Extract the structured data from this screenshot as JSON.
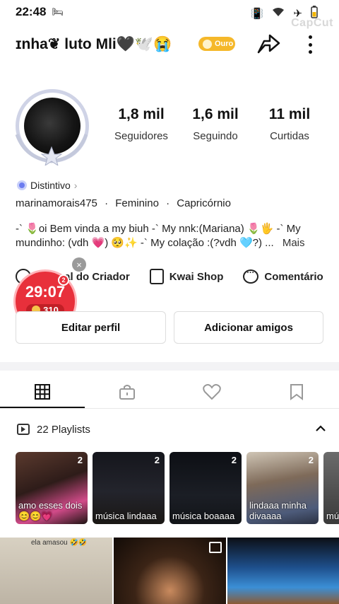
{
  "status_bar": {
    "time": "22:48",
    "watermark": "CapCut"
  },
  "profile": {
    "name": "ɪnha❦ luto Mli🖤🕊️😭",
    "rank_badge": "Ouro"
  },
  "stats": [
    {
      "value": "1,8 mil",
      "label": "Seguidores"
    },
    {
      "value": "1,6 mil",
      "label": "Seguindo"
    },
    {
      "value": "11 mil",
      "label": "Curtidas"
    }
  ],
  "badge": {
    "label": "Distintivo"
  },
  "info": {
    "username": "marinamorais475",
    "gender": "Feminino",
    "sign": "Capricórnio",
    "separator": "·"
  },
  "bio": {
    "text": "-` 🌷oi Bem vinda a my biuh -` My nnk:(Mariana) 🌷🖐️ -` My mundinho: (vdh 💗) 🥺✨ -` My colação :(?vdh 🩵?) ...",
    "more_label": "Mais"
  },
  "features": [
    {
      "label": "Central do Criador",
      "icon": "creator-center-icon"
    },
    {
      "label": "Kwai Shop",
      "icon": "shopping-bag-icon"
    },
    {
      "label": "Comentário",
      "icon": "comment-icon"
    }
  ],
  "timer": {
    "value": "29:07",
    "coins": "310",
    "mark": "2"
  },
  "buttons": {
    "edit_profile": "Editar perfil",
    "add_friends": "Adicionar amigos"
  },
  "tabs": [
    {
      "name": "grid-icon",
      "active": true
    },
    {
      "name": "private-lock-icon",
      "active": false
    },
    {
      "name": "heart-icon",
      "active": false
    },
    {
      "name": "bookmark-icon",
      "active": false
    }
  ],
  "playlists": {
    "header": "22 Playlists",
    "items": [
      {
        "count": "2",
        "title": "amo esses dois 😊😊💗"
      },
      {
        "count": "2",
        "title": "música lindaaa"
      },
      {
        "count": "2",
        "title": "música boaaaa"
      },
      {
        "count": "2",
        "title": "lindaaa minha divaaaa"
      },
      {
        "count": "",
        "title": "mú"
      }
    ]
  },
  "videos": [
    {
      "caption": "ela amasou 🤣🤣"
    },
    {
      "caption": ""
    },
    {
      "caption": ""
    }
  ],
  "colors": {
    "accent_red": "#e8303b",
    "rank_gold": "#f5b82a",
    "badge_blue": "#6b7cf0"
  }
}
